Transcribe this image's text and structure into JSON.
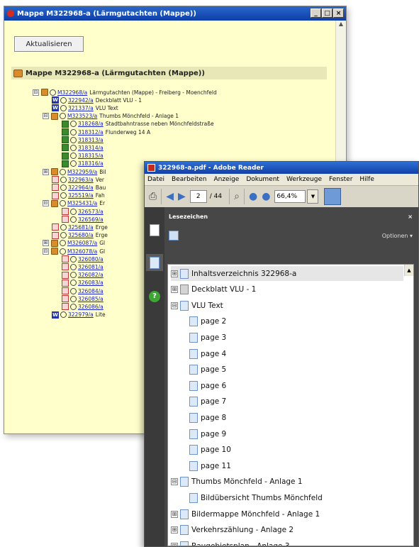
{
  "mappe_window": {
    "title": "Mappe M322968-a (Lärmgutachten (Mappe))",
    "refresh_label": "Aktualisieren",
    "header": "Mappe M322968-a (Lärmgutachten (Mappe))",
    "tree": [
      {
        "id": "M322968/a",
        "text": "Lärmgutachten (Mappe) - Freiberg - Moenchfeld",
        "toggle": "⊟",
        "icon": "folder"
      },
      {
        "id": "322942/a",
        "text": "Deckblatt VLU - 1",
        "toggle": "",
        "icon": "word"
      },
      {
        "id": "321337/a",
        "text": "VLU Text",
        "toggle": "",
        "icon": "word"
      },
      {
        "id": "M323523/a",
        "text": "Thumbs Mönchfeld - Anlage 1",
        "toggle": "⊟",
        "icon": "folder"
      },
      {
        "id": "318268/a",
        "text": "Stadtbahntrasse neben Mönchfeldstraße",
        "toggle": "",
        "icon": "img"
      },
      {
        "id": "318312/a",
        "text": "Flunderweg 14 A",
        "toggle": "",
        "icon": "img"
      },
      {
        "id": "318313/a",
        "text": "",
        "toggle": "",
        "icon": "img"
      },
      {
        "id": "318314/a",
        "text": "",
        "toggle": "",
        "icon": "img"
      },
      {
        "id": "318315/a",
        "text": "",
        "toggle": "",
        "icon": "img"
      },
      {
        "id": "318316/a",
        "text": "",
        "toggle": "",
        "icon": "img"
      },
      {
        "id": "M322959/a",
        "text": "Bil",
        "toggle": "⊞",
        "icon": "folder"
      },
      {
        "id": "322963/a",
        "text": "Ver",
        "toggle": "",
        "icon": "pdf"
      },
      {
        "id": "322964/a",
        "text": "Bau",
        "toggle": "",
        "icon": "pdf"
      },
      {
        "id": "325519/a",
        "text": "Fah",
        "toggle": "",
        "icon": "pdf"
      },
      {
        "id": "M325431/a",
        "text": "Er",
        "toggle": "⊟",
        "icon": "folder"
      },
      {
        "id": "326573/a",
        "text": "",
        "toggle": "",
        "icon": "pdf"
      },
      {
        "id": "326569/a",
        "text": "",
        "toggle": "",
        "icon": "pdf"
      },
      {
        "id": "325681/a",
        "text": "Erge",
        "toggle": "",
        "icon": "pdf"
      },
      {
        "id": "325680/a",
        "text": "Erge",
        "toggle": "",
        "icon": "pdf"
      },
      {
        "id": "M326087/a",
        "text": "Gl",
        "toggle": "⊞",
        "icon": "folder"
      },
      {
        "id": "M326078/a",
        "text": "Gl",
        "toggle": "⊟",
        "icon": "folder"
      },
      {
        "id": "326080/a",
        "text": "",
        "toggle": "",
        "icon": "pdf"
      },
      {
        "id": "326081/a",
        "text": "",
        "toggle": "",
        "icon": "pdf"
      },
      {
        "id": "326082/a",
        "text": "",
        "toggle": "",
        "icon": "pdf"
      },
      {
        "id": "326083/a",
        "text": "",
        "toggle": "",
        "icon": "pdf"
      },
      {
        "id": "326084/a",
        "text": "",
        "toggle": "",
        "icon": "pdf"
      },
      {
        "id": "326085/a",
        "text": "",
        "toggle": "",
        "icon": "pdf"
      },
      {
        "id": "326086/a",
        "text": "",
        "toggle": "",
        "icon": "pdf"
      },
      {
        "id": "322979/a",
        "text": "Lite",
        "toggle": "",
        "icon": "word"
      }
    ]
  },
  "reader_window": {
    "title": "322968-a.pdf - Adobe Reader",
    "menu": [
      "Datei",
      "Bearbeiten",
      "Anzeige",
      "Dokument",
      "Werkzeuge",
      "Fenster",
      "Hilfe"
    ],
    "page_current": "2",
    "page_total": "/ 44",
    "zoom": "66,4%",
    "panel_title": "Lesezeichen",
    "panel_close": "×",
    "options_label": "Optionen ▾",
    "bookmarks": [
      {
        "label": "Inhaltsverzeichnis 322968-a",
        "toggle": "⊞",
        "level": 0,
        "icon": "blue",
        "selected": true
      },
      {
        "label": "Deckblatt VLU - 1",
        "toggle": "⊞",
        "level": 0,
        "icon": "grey"
      },
      {
        "label": "VLU Text",
        "toggle": "⊟",
        "level": 0,
        "icon": "blue"
      },
      {
        "label": "page 2",
        "toggle": "",
        "level": 1,
        "icon": "blue"
      },
      {
        "label": "page 3",
        "toggle": "",
        "level": 1,
        "icon": "blue"
      },
      {
        "label": "page 4",
        "toggle": "",
        "level": 1,
        "icon": "blue"
      },
      {
        "label": "page 5",
        "toggle": "",
        "level": 1,
        "icon": "blue"
      },
      {
        "label": "page 6",
        "toggle": "",
        "level": 1,
        "icon": "blue"
      },
      {
        "label": "page 7",
        "toggle": "",
        "level": 1,
        "icon": "blue"
      },
      {
        "label": "page 8",
        "toggle": "",
        "level": 1,
        "icon": "blue"
      },
      {
        "label": "page 9",
        "toggle": "",
        "level": 1,
        "icon": "blue"
      },
      {
        "label": "page 10",
        "toggle": "",
        "level": 1,
        "icon": "blue"
      },
      {
        "label": "page 11",
        "toggle": "",
        "level": 1,
        "icon": "blue"
      },
      {
        "label": "Thumbs Mönchfeld - Anlage 1",
        "toggle": "⊟",
        "level": 0,
        "icon": "blue"
      },
      {
        "label": "Bildübersicht Thumbs Mönchfeld",
        "toggle": "",
        "level": 1,
        "icon": "blue"
      },
      {
        "label": "Bildermappe Mönchfeld - Anlage 1",
        "toggle": "⊞",
        "level": 0,
        "icon": "blue"
      },
      {
        "label": "Verkehrszählung - Anlage 2",
        "toggle": "⊞",
        "level": 0,
        "icon": "blue"
      },
      {
        "label": "Baugebietsplan - Anlage 3",
        "toggle": "⊞",
        "level": 0,
        "icon": "blue"
      }
    ]
  }
}
